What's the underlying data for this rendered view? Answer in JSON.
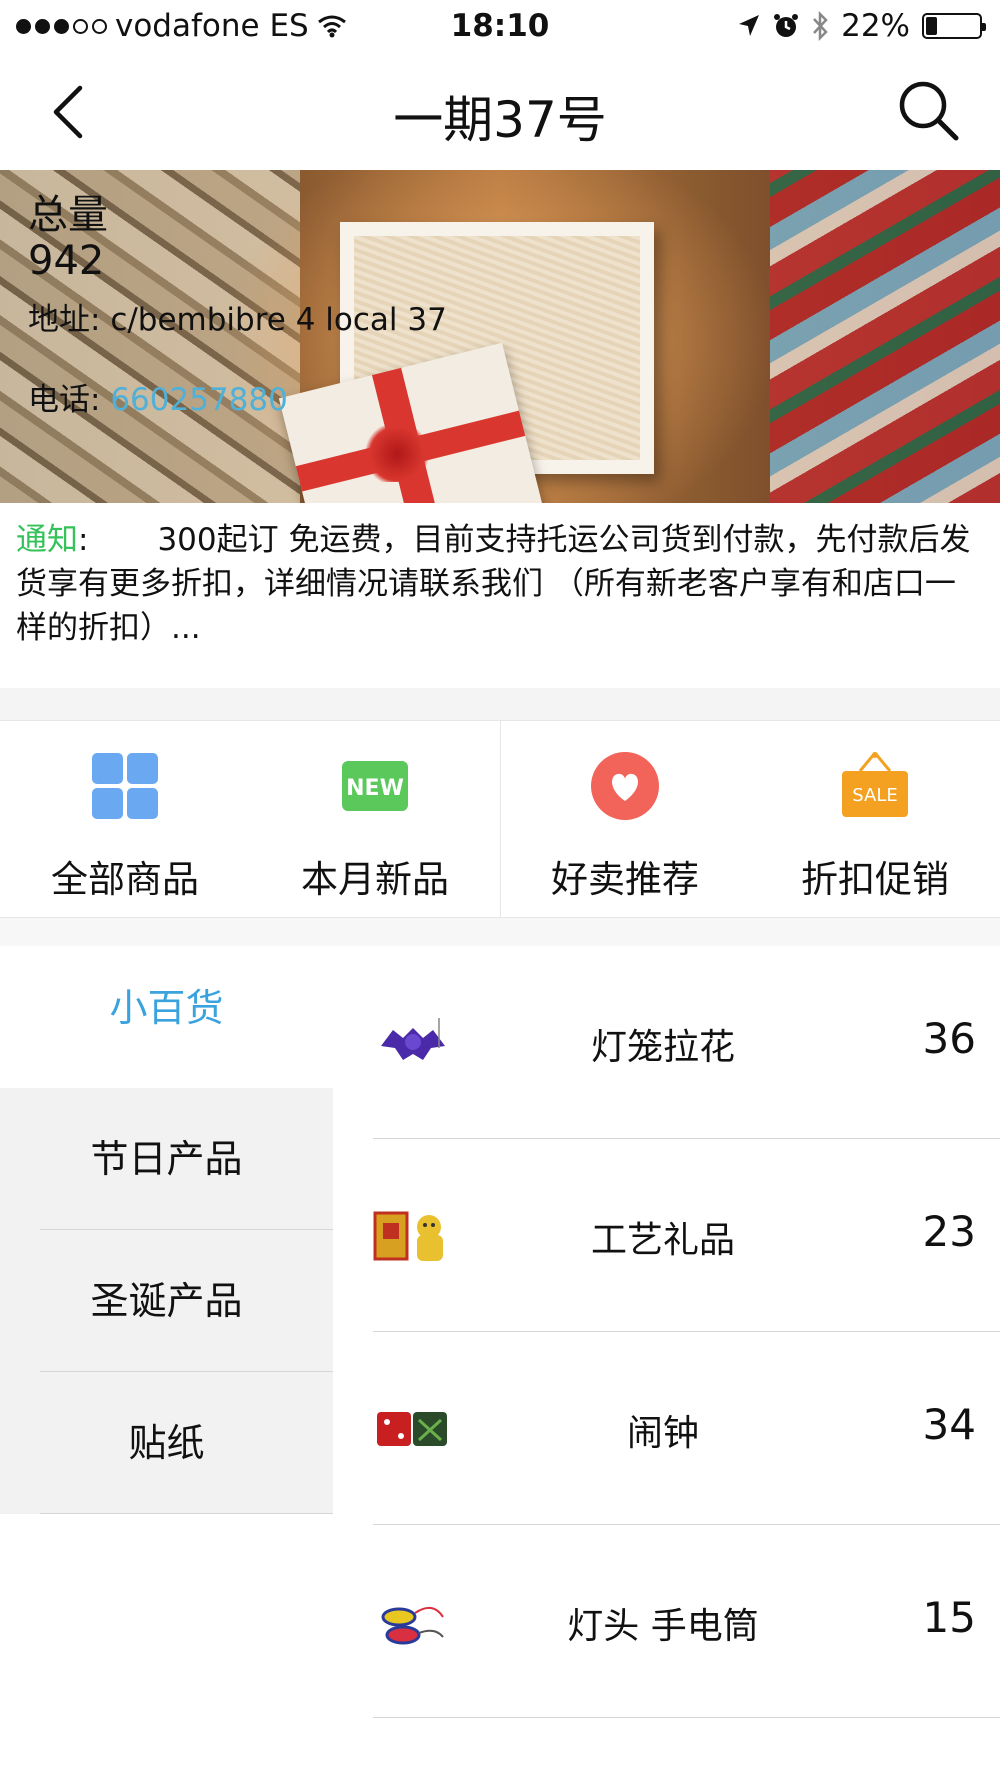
{
  "status_bar": {
    "carrier": "vodafone ES",
    "time": "18:10",
    "battery": "22%",
    "battery_level": 0.22,
    "icons": [
      "signal-dots",
      "wifi-icon",
      "location-arrow-icon",
      "alarm-icon",
      "bluetooth-icon",
      "battery-icon"
    ]
  },
  "nav": {
    "title": "一期37号",
    "back_icon": "chevron-left-icon",
    "search_icon": "search-icon"
  },
  "banner": {
    "total_label": "总量",
    "total_value": "942",
    "address_label": "地址:",
    "address_value": "c/bembibre 4 local 37",
    "phone_label": "电话:",
    "phone_value": "660257880"
  },
  "notice": {
    "label": "通知",
    "separator": ":",
    "text": "300起订 免运费，目前支持托运公司货到付款，先付款后发货享有更多折扣，详细情况请联系我们 （所有新老客户享有和店口一样的折扣）..."
  },
  "categories": [
    {
      "label": "全部商品",
      "icon": "grid-icon",
      "color": "#6aa9f2"
    },
    {
      "label": "本月新品",
      "icon": "new-badge-icon",
      "color": "#5ac85a"
    },
    {
      "label": "好卖推荐",
      "icon": "heart-icon",
      "color": "#f2645a"
    },
    {
      "label": "折扣促销",
      "icon": "sale-sign-icon",
      "color": "#f4a020"
    }
  ],
  "sidebar": {
    "items": [
      {
        "label": "小百货",
        "active": true
      },
      {
        "label": "节日产品",
        "active": false
      },
      {
        "label": "圣诞产品",
        "active": false
      },
      {
        "label": "贴纸",
        "active": false
      }
    ]
  },
  "products": [
    {
      "name": "灯笼拉花",
      "count": "36",
      "thumb": "bat-decoration-thumbnail"
    },
    {
      "name": "工艺礼品",
      "count": "23",
      "thumb": "lucky-cat-thumbnail"
    },
    {
      "name": "闹钟",
      "count": "34",
      "thumb": "dice-clock-thumbnail"
    },
    {
      "name": "灯头 手电筒",
      "count": "15",
      "thumb": "keychain-light-thumbnail"
    }
  ],
  "colors": {
    "accent": "#3aa3de",
    "notice_label": "#35c25a",
    "phone_link": "#4fb0d8"
  }
}
